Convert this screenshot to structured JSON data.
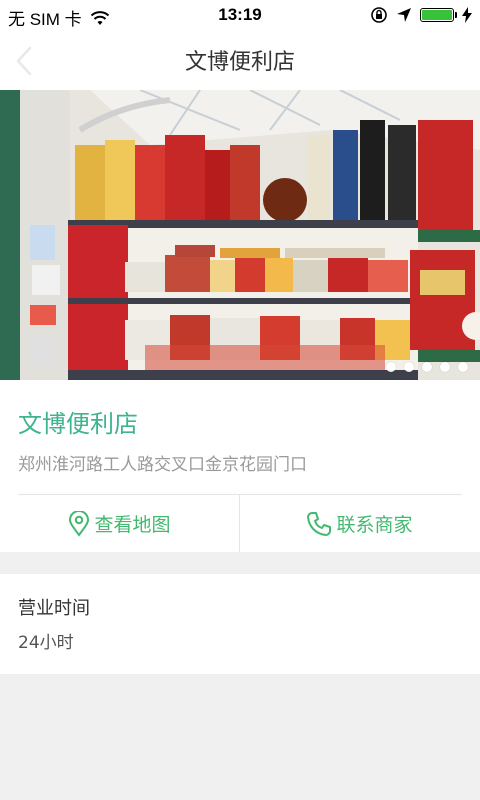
{
  "status_bar": {
    "carrier": "无 SIM 卡",
    "time": "13:19",
    "battery_level": 1.0
  },
  "nav": {
    "title": "文博便利店"
  },
  "hero": {
    "carousel_count": 5,
    "active_index": 0
  },
  "shop": {
    "name": "文博便利店",
    "address": "郑州淮河路工人路交叉口金京花园门口"
  },
  "actions": {
    "map_label": "查看地图",
    "contact_label": "联系商家"
  },
  "hours": {
    "label": "营业时间",
    "value": "24小时"
  },
  "colors": {
    "accent": "#3db48f",
    "action": "#43b86f",
    "battery": "#38c23a"
  }
}
